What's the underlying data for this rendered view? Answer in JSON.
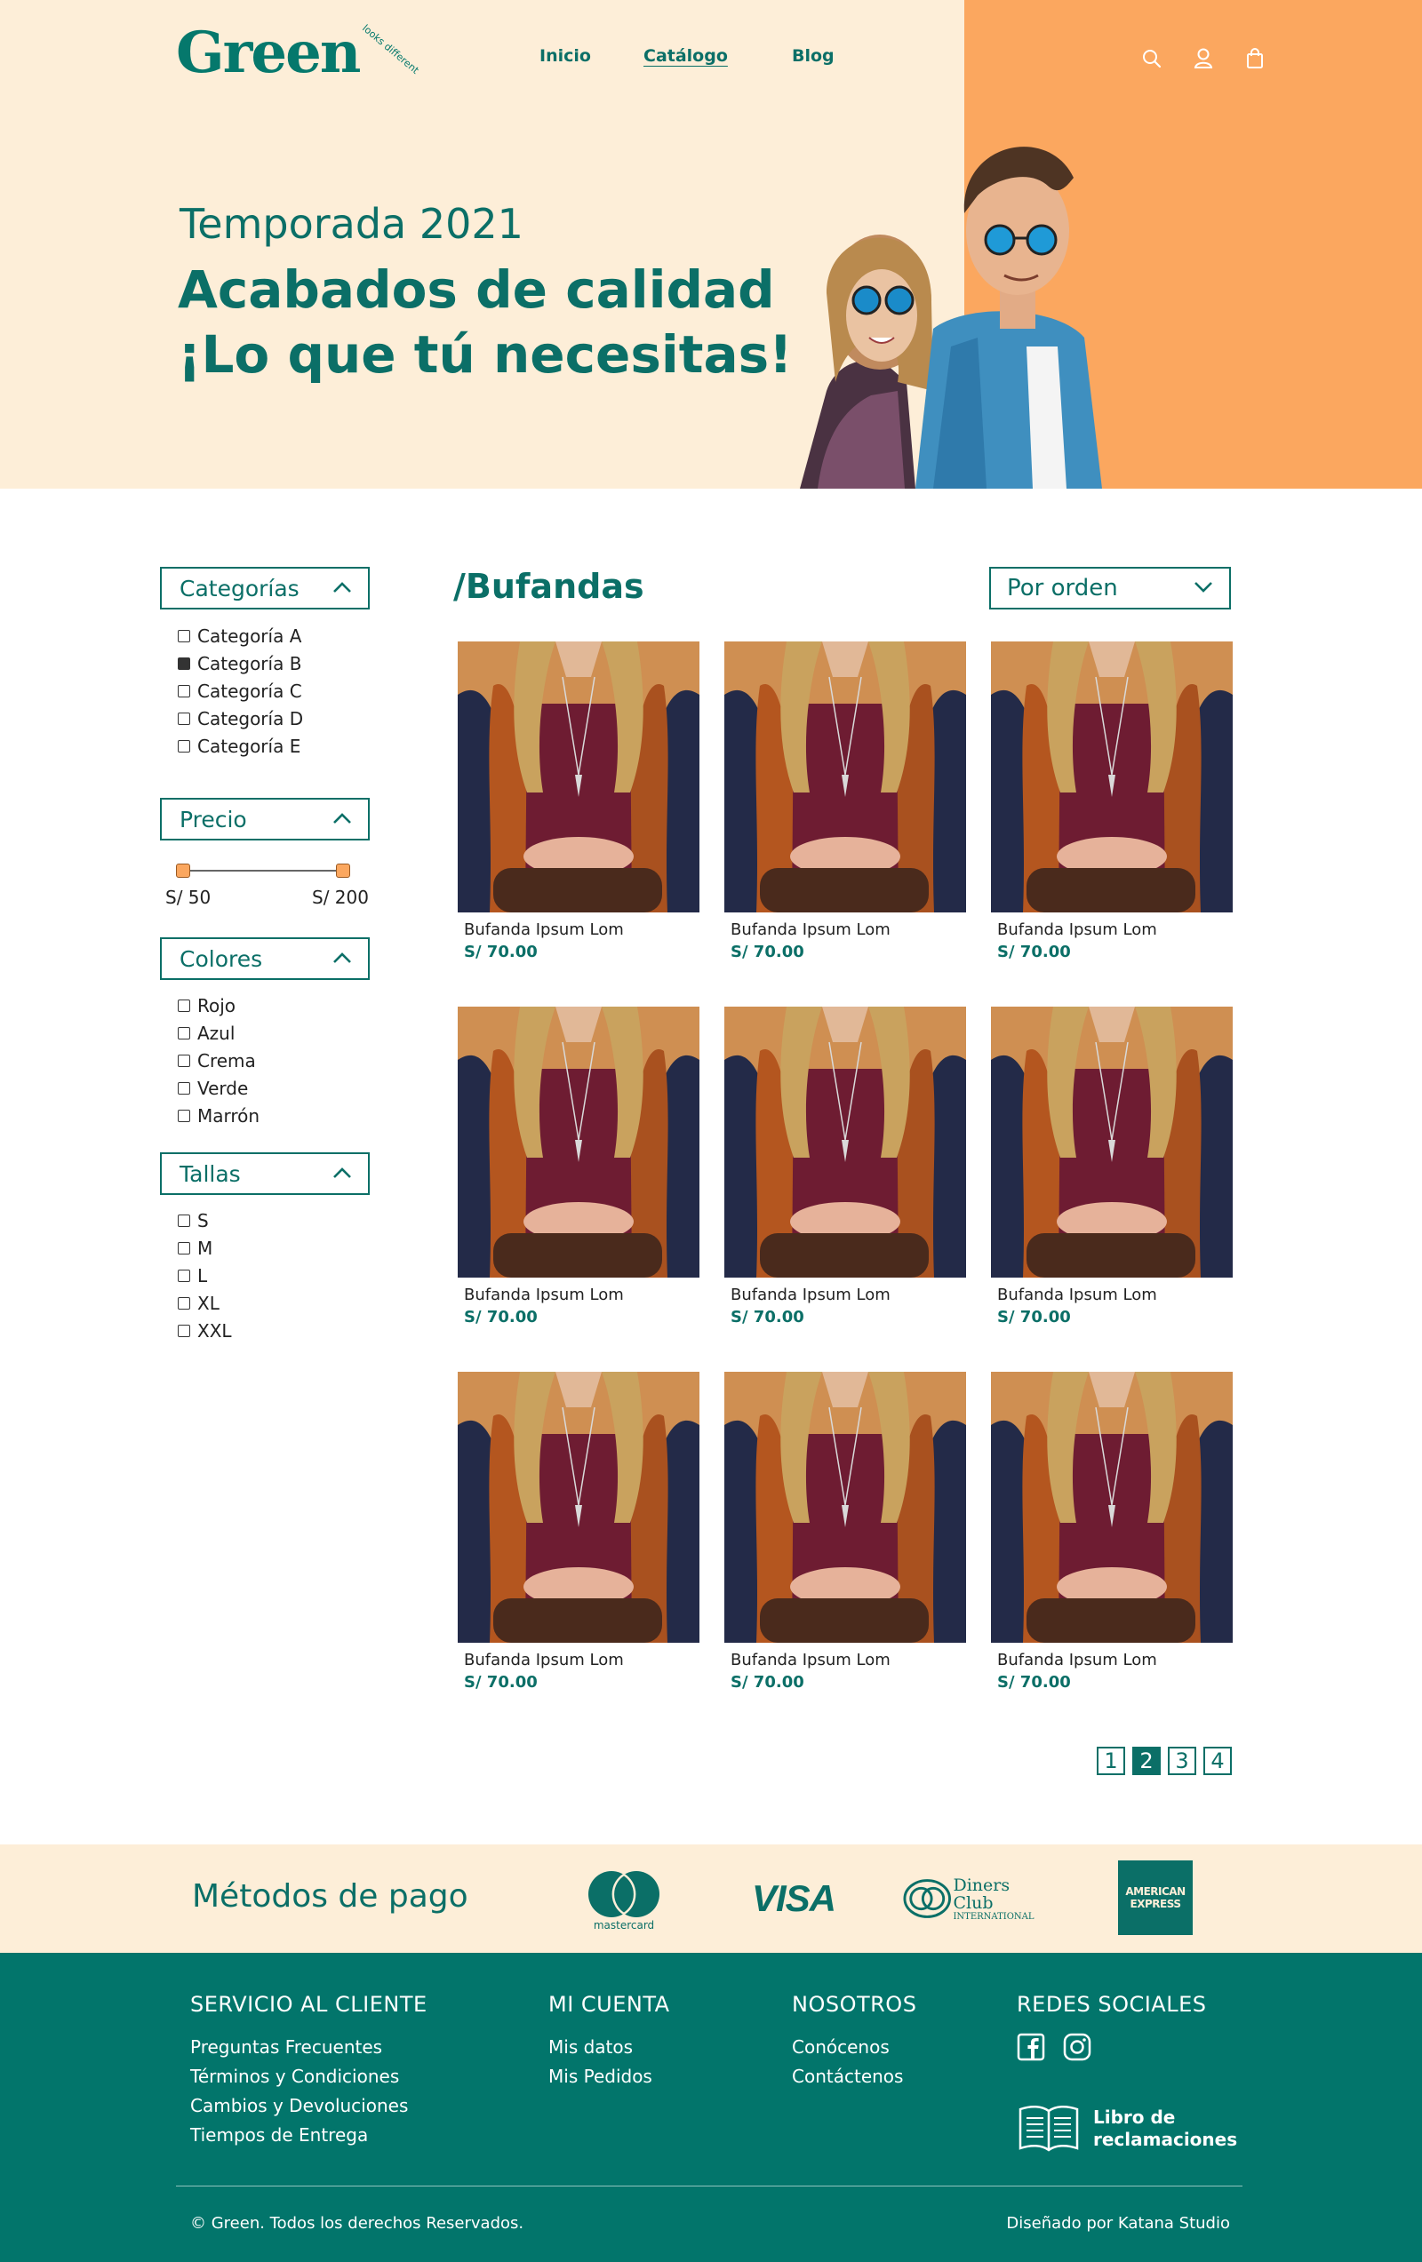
{
  "brand": {
    "name": "Green",
    "tagline": "looks different",
    "registered": "®"
  },
  "nav": {
    "items": [
      "Inicio",
      "Catálogo",
      "Blog"
    ],
    "active": "Catálogo"
  },
  "header_icons": [
    "search-icon",
    "user-icon",
    "shopping-bag-icon"
  ],
  "hero": {
    "subtitle": "Temporada 2021",
    "title_line1": "Acabados de calidad",
    "title_line2": "¡Lo que tú necesitas!"
  },
  "filters": {
    "categories": {
      "title": "Categorías",
      "options": [
        {
          "label": "Categoría A",
          "checked": false
        },
        {
          "label": "Categoría B",
          "checked": true
        },
        {
          "label": "Categoría C",
          "checked": false
        },
        {
          "label": "Categoría D",
          "checked": false
        },
        {
          "label": "Categoría E",
          "checked": false
        }
      ]
    },
    "price": {
      "title": "Precio",
      "min_label": "S/ 50",
      "max_label": "S/ 200"
    },
    "colors": {
      "title": "Colores",
      "options": [
        "Rojo",
        "Azul",
        "Crema",
        "Verde",
        "Marrón"
      ]
    },
    "sizes": {
      "title": "Tallas",
      "options": [
        "S",
        "M",
        "L",
        "XL",
        "XXL"
      ]
    }
  },
  "catalog": {
    "title": "/Bufandas",
    "sort_label": "Por orden",
    "products": [
      {
        "name": "Bufanda Ipsum Lom",
        "price": "S/ 70.00"
      },
      {
        "name": "Bufanda Ipsum Lom",
        "price": "S/ 70.00"
      },
      {
        "name": "Bufanda Ipsum Lom",
        "price": "S/ 70.00"
      },
      {
        "name": "Bufanda Ipsum Lom",
        "price": "S/ 70.00"
      },
      {
        "name": "Bufanda Ipsum Lom",
        "price": "S/ 70.00"
      },
      {
        "name": "Bufanda Ipsum Lom",
        "price": "S/ 70.00"
      },
      {
        "name": "Bufanda Ipsum Lom",
        "price": "S/ 70.00"
      },
      {
        "name": "Bufanda Ipsum Lom",
        "price": "S/ 70.00"
      },
      {
        "name": "Bufanda Ipsum Lom",
        "price": "S/ 70.00"
      }
    ],
    "pagination": {
      "pages": [
        "1",
        "2",
        "3",
        "4"
      ],
      "current": "2"
    }
  },
  "payment": {
    "title": "Métodos de pago",
    "methods": [
      {
        "name": "mastercard",
        "label": "mastercard"
      },
      {
        "name": "visa",
        "label": "VISA"
      },
      {
        "name": "diners",
        "label_line1": "Diners Club",
        "label_line2": "INTERNATIONAL"
      },
      {
        "name": "amex",
        "label_line1": "AMERICAN",
        "label_line2": "EXPRESS"
      }
    ]
  },
  "footer": {
    "columns": [
      {
        "title": "SERVICIO AL CLIENTE",
        "links": [
          "Preguntas Frecuentes",
          "Términos y Condiciones",
          "Cambios y Devoluciones",
          "Tiempos de Entrega"
        ]
      },
      {
        "title": "MI CUENTA",
        "links": [
          "Mis datos",
          "Mis Pedidos"
        ]
      },
      {
        "title": "NOSOTROS",
        "links": [
          "Conócenos",
          "Contáctenos"
        ]
      },
      {
        "title": "REDES SOCIALES",
        "links": []
      }
    ],
    "social_icons": [
      "facebook-icon",
      "instagram-icon"
    ],
    "complaints_book": {
      "line1": "Libro de",
      "line2": "reclamaciones"
    },
    "copyright": "© Green. Todos los derechos Reservados.",
    "credit": "Diseñado por Katana Studio"
  },
  "colors": {
    "primary": "#0b6f67",
    "footer_bg": "#02756b",
    "cream": "#fdeed8",
    "orange": "#fba75f"
  }
}
